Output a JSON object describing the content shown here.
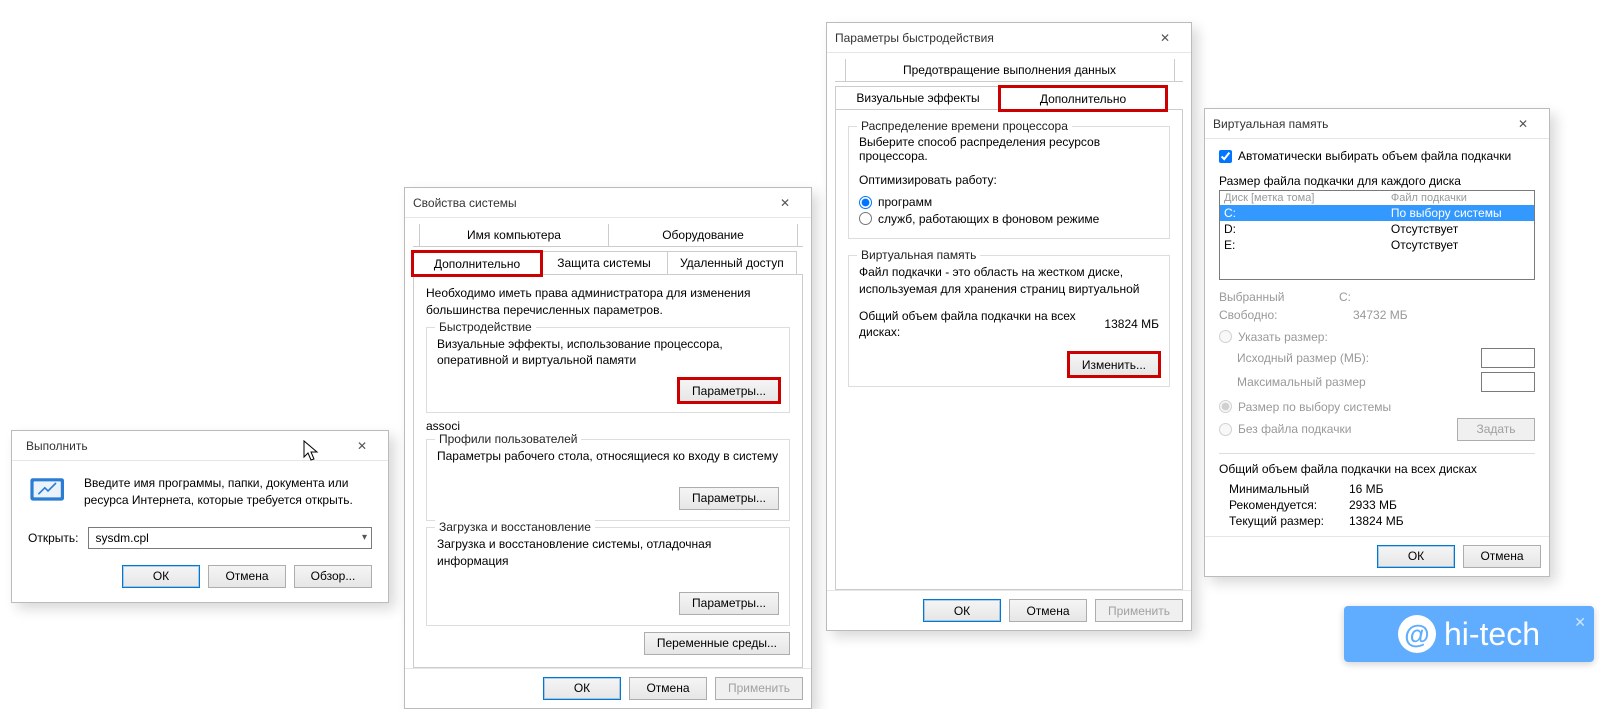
{
  "run": {
    "title": "Выполнить",
    "desc": "Введите имя программы, папки, документа или ресурса Интернета, которые требуется открыть.",
    "open_label": "Открыть:",
    "value": "sysdm.cpl",
    "ok": "ОК",
    "cancel": "Отмена",
    "browse": "Обзор..."
  },
  "sysprops": {
    "title": "Свойства системы",
    "tabs_row1": [
      "Имя компьютера",
      "Оборудование"
    ],
    "tabs_row2": [
      "Дополнительно",
      "Защита системы",
      "Удаленный доступ"
    ],
    "note": "Необходимо иметь права администратора для изменения большинства перечисленных параметров.",
    "perf_legend": "Быстродействие",
    "perf_desc": "Визуальные эффекты, использование процессора, оперативной и виртуальной памяти",
    "perf_btn": "Параметры...",
    "profiles_legend": "Профили пользователей",
    "profiles_desc": "Параметры рабочего стола, относящиеся ко входу в систему",
    "profiles_btn": "Параметры...",
    "boot_legend": "Загрузка и восстановление",
    "boot_desc": "Загрузка и восстановление системы, отладочная информация",
    "boot_btn": "Параметры...",
    "envvars_btn": "Переменные среды...",
    "ok": "ОК",
    "cancel": "Отмена",
    "apply": "Применить"
  },
  "perfopts": {
    "title": "Параметры быстродействия",
    "tabs_row1": [
      "Предотвращение выполнения данных"
    ],
    "tabs_row2": [
      "Визуальные эффекты",
      "Дополнительно"
    ],
    "cpu_legend": "Распределение времени процессора",
    "cpu_desc": "Выберите способ распределения ресурсов процессора.",
    "cpu_optimize": "Оптимизировать работу:",
    "cpu_radio1": "программ",
    "cpu_radio2": "служб, работающих в фоновом режиме",
    "vm_legend": "Виртуальная память",
    "vm_desc": "Файл подкачки - это область на жестком диске, используемая для хранения страниц виртуальной",
    "vm_total_label": "Общий объем файла подкачки на всех дисках:",
    "vm_total_value": "13824 МБ",
    "vm_change": "Изменить...",
    "ok": "ОК",
    "cancel": "Отмена",
    "apply": "Применить"
  },
  "vm": {
    "title": "Виртуальная память",
    "auto": "Автоматически выбирать объем файла подкачки",
    "size_head": "Размер файла подкачки для каждого диска",
    "col_drive": "Диск [метка тома]",
    "col_pf": "Файл подкачки",
    "drives": [
      {
        "d": "C:",
        "pf": "По выбору системы",
        "sel": true
      },
      {
        "d": "D:",
        "pf": "Отсутствует",
        "sel": false
      },
      {
        "d": "E:",
        "pf": "Отсутствует",
        "sel": false
      }
    ],
    "selected_label": "Выбранный",
    "selected_drive": "С:",
    "free_label": "Свободно:",
    "free_value": "34732 МБ",
    "opt_custom": "Указать размер:",
    "isize": "Исходный размер (МБ):",
    "msize": "Максимальный размер",
    "opt_system": "Размер по выбору системы",
    "opt_none": "Без файла подкачки",
    "set_btn": "Задать",
    "totals_head": "Общий объем файла подкачки на всех дисках",
    "min_label": "Минимальный",
    "min_value": "16 МБ",
    "rec_label": "Рекомендуется:",
    "rec_value": "2933 МБ",
    "cur_label": "Текущий размер:",
    "cur_value": "13824 МБ",
    "ok": "ОК",
    "cancel": "Отмена"
  },
  "watermark": "hi-tech"
}
